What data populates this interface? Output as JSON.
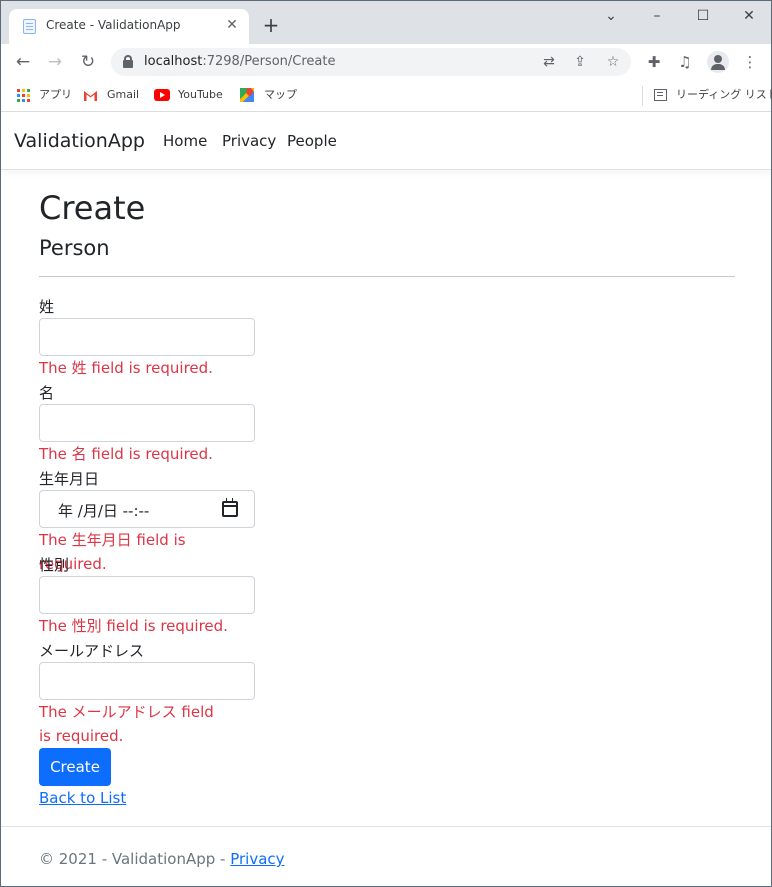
{
  "browser": {
    "tab_title": "Create - ValidationApp",
    "url_host": "localhost",
    "url_path": ":7298/Person/Create",
    "bookmarks": [
      {
        "label": "アプリ",
        "icon": "apps-grid-icon"
      },
      {
        "label": "Gmail",
        "icon": "gmail-icon"
      },
      {
        "label": "YouTube",
        "icon": "youtube-icon"
      },
      {
        "label": "マップ",
        "icon": "maps-icon"
      }
    ],
    "reading_list": "リーディング リスト"
  },
  "site": {
    "brand": "ValidationApp",
    "nav": [
      "Home",
      "Privacy",
      "People"
    ]
  },
  "page": {
    "title": "Create",
    "subtitle": "Person"
  },
  "form": {
    "fields": [
      {
        "label": "姓",
        "error": "The 姓 field is required.",
        "value": ""
      },
      {
        "label": "名",
        "error": "The 名 field is required.",
        "value": ""
      },
      {
        "label": "生年月日",
        "error": "The 生年月日 field is required.",
        "value": "年 /月/日 --:--"
      },
      {
        "label": "性別",
        "error": "The 性別 field is required.",
        "value": ""
      },
      {
        "label": "メールアドレス",
        "error": "The メールアドレス field is required.",
        "value": ""
      }
    ],
    "submit_label": "Create",
    "back_link": "Back to List"
  },
  "footer": {
    "text": "© 2021 - ValidationApp - ",
    "link": "Privacy"
  },
  "colors": {
    "primary": "#0d6efd",
    "error": "#dc3545",
    "text": "#212529",
    "muted": "#6c757d"
  }
}
